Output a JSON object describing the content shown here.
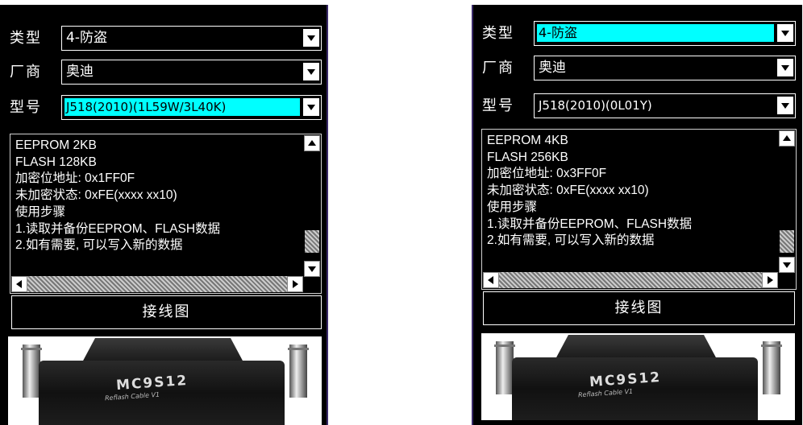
{
  "panels": [
    {
      "type_label": "类型",
      "type_value": "4-防盗",
      "maker_label": "厂商",
      "maker_value": "奥迪",
      "model_label": "型号",
      "model_value": "J518(2010)(1L59W/3L40K)",
      "info_lines": [
        "EEPROM 2KB",
        "FLASH 128KB",
        "加密位地址: 0x1FF0F",
        "未加密状态: 0xFE(xxxx xx10)",
        "使用步骤",
        "1.读取并备份EEPROM、FLASH数据",
        "2.如有需要, 可以写入新的数据"
      ],
      "wiring_button": "接线图",
      "cable_brand": "MC9S12",
      "cable_sub": "Reflash Cable V1"
    },
    {
      "type_label": "类型",
      "type_value": "4-防盗",
      "maker_label": "厂商",
      "maker_value": "奥迪",
      "model_label": "型号",
      "model_value": "J518(2010)(0L01Y)",
      "info_lines": [
        "EEPROM 4KB",
        "FLASH 256KB",
        "加密位地址: 0x3FF0F",
        "未加密状态: 0xFE(xxxx xx10)",
        "使用步骤",
        "1.读取并备份EEPROM、FLASH数据",
        "2.如有需要, 可以写入新的数据"
      ],
      "wiring_button": "接线图",
      "cable_brand": "MC9S12",
      "cable_sub": "Reflash Cable V1"
    }
  ],
  "colors": {
    "background": "#000000",
    "highlight": "#00ffff",
    "text": "#ffffff"
  }
}
